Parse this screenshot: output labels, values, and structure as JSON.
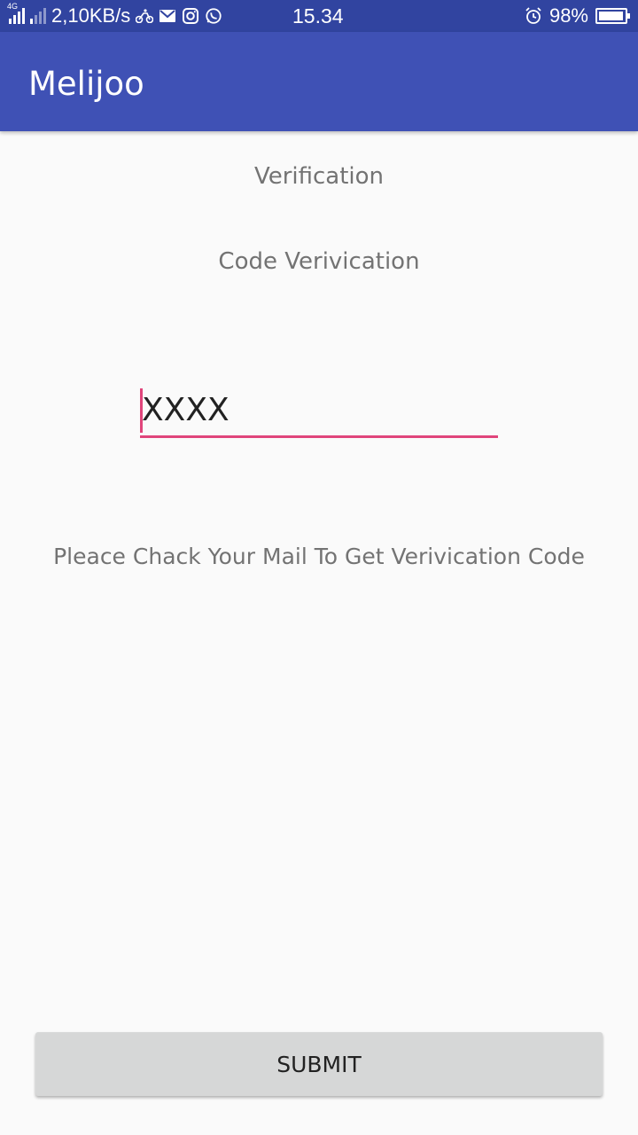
{
  "status_bar": {
    "network_type": "4G",
    "data_speed": "2,10KB/s",
    "time": "15.34",
    "battery_percent": "98%",
    "battery_level": 0.98,
    "icons": [
      "signal-icon",
      "signal-icon",
      "bike-icon",
      "gmail-icon",
      "instagram-icon",
      "whatsapp-icon",
      "alarm-icon",
      "battery-icon"
    ]
  },
  "app_bar": {
    "title": "Melijoo",
    "color": "#3f51b5"
  },
  "main": {
    "title": "Verification",
    "subtitle": "Code Verivication",
    "code_input": {
      "value": "XXXX",
      "accent_color": "#e0457b"
    },
    "hint": "Pleace Chack Your Mail To Get Verivication Code"
  },
  "footer": {
    "submit_label": "SUBMIT"
  }
}
